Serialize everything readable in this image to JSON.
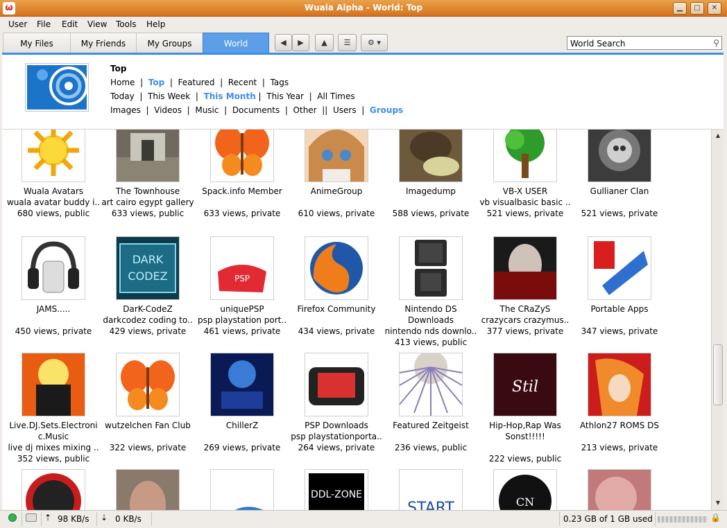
{
  "window": {
    "title": "Wuala Alpha - World: Top",
    "app_icon": "wuala-icon"
  },
  "menu": [
    "User",
    "File",
    "Edit",
    "View",
    "Tools",
    "Help"
  ],
  "tabs": [
    "My Files",
    "My Friends",
    "My Groups",
    "World"
  ],
  "search": {
    "value": "World Search"
  },
  "header": {
    "title": "Top",
    "row1": [
      "Home",
      "Top",
      "Featured",
      "Recent",
      "Tags"
    ],
    "row2": [
      "Today",
      "This Week",
      "This Month",
      "This Year",
      "All Times"
    ],
    "row3": [
      "Images",
      "Videos",
      "Music",
      "Documents",
      "Other",
      "Users",
      "Groups"
    ]
  },
  "groups": [
    {
      "name": "Wuala Avatars",
      "desc": "wuala avatar buddy i..",
      "stats": "680 views, public"
    },
    {
      "name": "The Townhouse",
      "desc": "art cairo egypt gallery",
      "stats": "633 views, public"
    },
    {
      "name": "Spack.info Member",
      "desc": "",
      "stats": "633 views, private"
    },
    {
      "name": "AnimeGroup",
      "desc": "",
      "stats": "610 views, private"
    },
    {
      "name": "Imagedump",
      "desc": "",
      "stats": "588 views, private"
    },
    {
      "name": "VB-X USER",
      "desc": "vb visualbasic basic ..",
      "stats": "521 views, private"
    },
    {
      "name": "Gullianer Clan",
      "desc": "",
      "stats": "521 views, private"
    },
    {
      "name": "JAMS.....",
      "desc": "",
      "stats": "450 views, private"
    },
    {
      "name": "DarK-CodeZ",
      "desc": "darkcodez coding to..",
      "stats": "429 views, private"
    },
    {
      "name": "uniquePSP",
      "desc": "psp playstation port..",
      "stats": "461 views, private"
    },
    {
      "name": "Firefox Community",
      "desc": "",
      "stats": "434 views, private"
    },
    {
      "name": "Nintendo DS",
      "name2": "Downloads",
      "desc": "nintendo nds downlo..",
      "stats": "413 views, public"
    },
    {
      "name": "The CRaZyS",
      "desc": "crazycars crazymus..",
      "stats": "377 views, private"
    },
    {
      "name": "Portable Apps",
      "desc": "",
      "stats": "347 views, private"
    },
    {
      "name": "Live.DJ.Sets.Electroni",
      "name2": "c.Music",
      "desc": "live dj mixes mixing ..",
      "stats": "352 views, public"
    },
    {
      "name": "wutzelchen Fan Club",
      "desc": "",
      "stats": "322 views, private"
    },
    {
      "name": "ChillerZ",
      "desc": "",
      "stats": "269 views, private"
    },
    {
      "name": "PSP Downloads",
      "desc": "psp playstationporta..",
      "stats": "264 views, private"
    },
    {
      "name": "Featured Zeitgeist",
      "desc": "",
      "stats": "236 views, public"
    },
    {
      "name": "Hip-Hop,Rap Was",
      "name2": "Sonst!!!!!",
      "desc": "",
      "stats": "222 views, public"
    },
    {
      "name": "Athlon27 ROMS DS",
      "desc": "",
      "stats": "213 views, private"
    }
  ],
  "status": {
    "upload_speed": "98 KB/s",
    "download_speed": "0 KB/s",
    "storage": "0.23 GB of 1 GB used"
  },
  "colors": {
    "accent": "#3b8ee8",
    "titlebar": "#d5721c",
    "selected_link": "#3b8ee8"
  }
}
